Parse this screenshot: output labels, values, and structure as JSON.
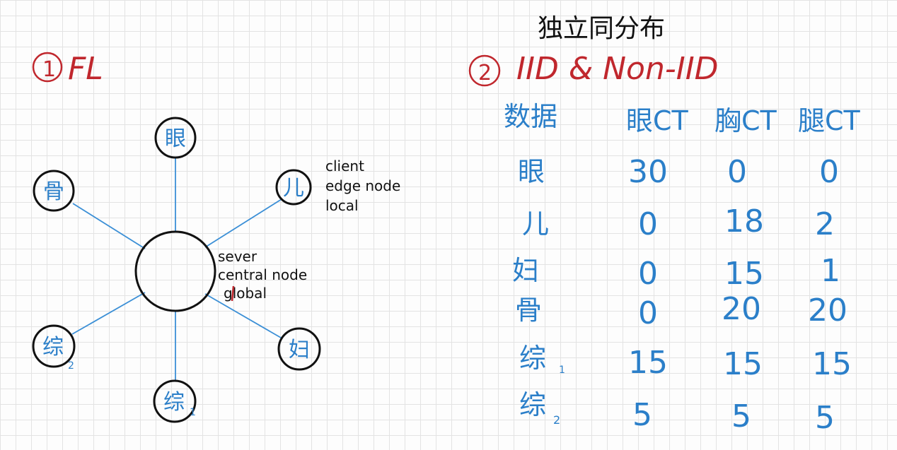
{
  "top_title": "独立同分布",
  "section1": {
    "number": "①",
    "label": "FL"
  },
  "section2": {
    "number": "②",
    "label": "IID & Non-IID"
  },
  "center_node_notes": [
    "sever",
    "central node",
    "global"
  ],
  "client_node_notes": [
    "client",
    "edge node",
    "local"
  ],
  "nodes": [
    {
      "label": "眼",
      "sub": ""
    },
    {
      "label": "儿",
      "sub": ""
    },
    {
      "label": "妇",
      "sub": ""
    },
    {
      "label": "综",
      "sub": "1"
    },
    {
      "label": "综",
      "sub": "2"
    },
    {
      "label": "骨",
      "sub": ""
    }
  ],
  "table": {
    "corner": "数据",
    "columns": [
      "眼CT",
      "胸CT",
      "腿CT"
    ],
    "rows": [
      {
        "label": "眼",
        "sub": "",
        "values": [
          "30",
          "0",
          "0"
        ]
      },
      {
        "label": "儿",
        "sub": "",
        "values": [
          "0",
          "18",
          "2"
        ]
      },
      {
        "label": "妇",
        "sub": "",
        "values": [
          "0",
          "15",
          "1"
        ]
      },
      {
        "label": "骨",
        "sub": "",
        "values": [
          "0",
          "20",
          "20"
        ]
      },
      {
        "label": "综",
        "sub": "1",
        "values": [
          "15",
          "15",
          "15"
        ]
      },
      {
        "label": "综",
        "sub": "2",
        "values": [
          "5",
          "5",
          "5"
        ]
      }
    ]
  },
  "colors": {
    "title_red": "#c0272d",
    "ink_blue": "#2b7fc9",
    "ink_black": "#111111",
    "line_blue": "#3b8fd6"
  }
}
